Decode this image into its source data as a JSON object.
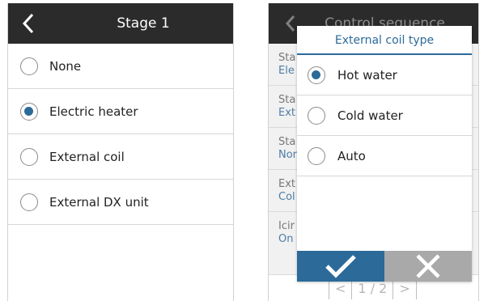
{
  "stage_screen": {
    "title": "Stage 1",
    "options": [
      {
        "label": "None",
        "selected": false
      },
      {
        "label": "Electric heater",
        "selected": true
      },
      {
        "label": "External coil",
        "selected": false
      },
      {
        "label": "External DX unit",
        "selected": false
      }
    ]
  },
  "control_sequence_screen": {
    "title": "Control sequence",
    "rows": [
      {
        "label": "Sta",
        "value": "Ele"
      },
      {
        "label": "Sta",
        "value": "Ext"
      },
      {
        "label": "Sta",
        "value": "Nor"
      },
      {
        "label": "Ext",
        "value": "Col"
      },
      {
        "label": "Icir",
        "value": "On"
      }
    ],
    "pager": {
      "current": "1",
      "separator": "/",
      "total": "2"
    }
  },
  "dialog": {
    "title": "External coil type",
    "options": [
      {
        "label": "Hot water",
        "selected": true
      },
      {
        "label": "Cold water",
        "selected": false
      },
      {
        "label": "Auto",
        "selected": false
      }
    ]
  },
  "icons": {
    "back": "chevron-left-icon",
    "ok": "check-icon",
    "cancel": "close-icon"
  },
  "colors": {
    "header_bg": "#2b2b2b",
    "accent": "#2c6a99",
    "cancel_bg": "#a9a9a9"
  }
}
